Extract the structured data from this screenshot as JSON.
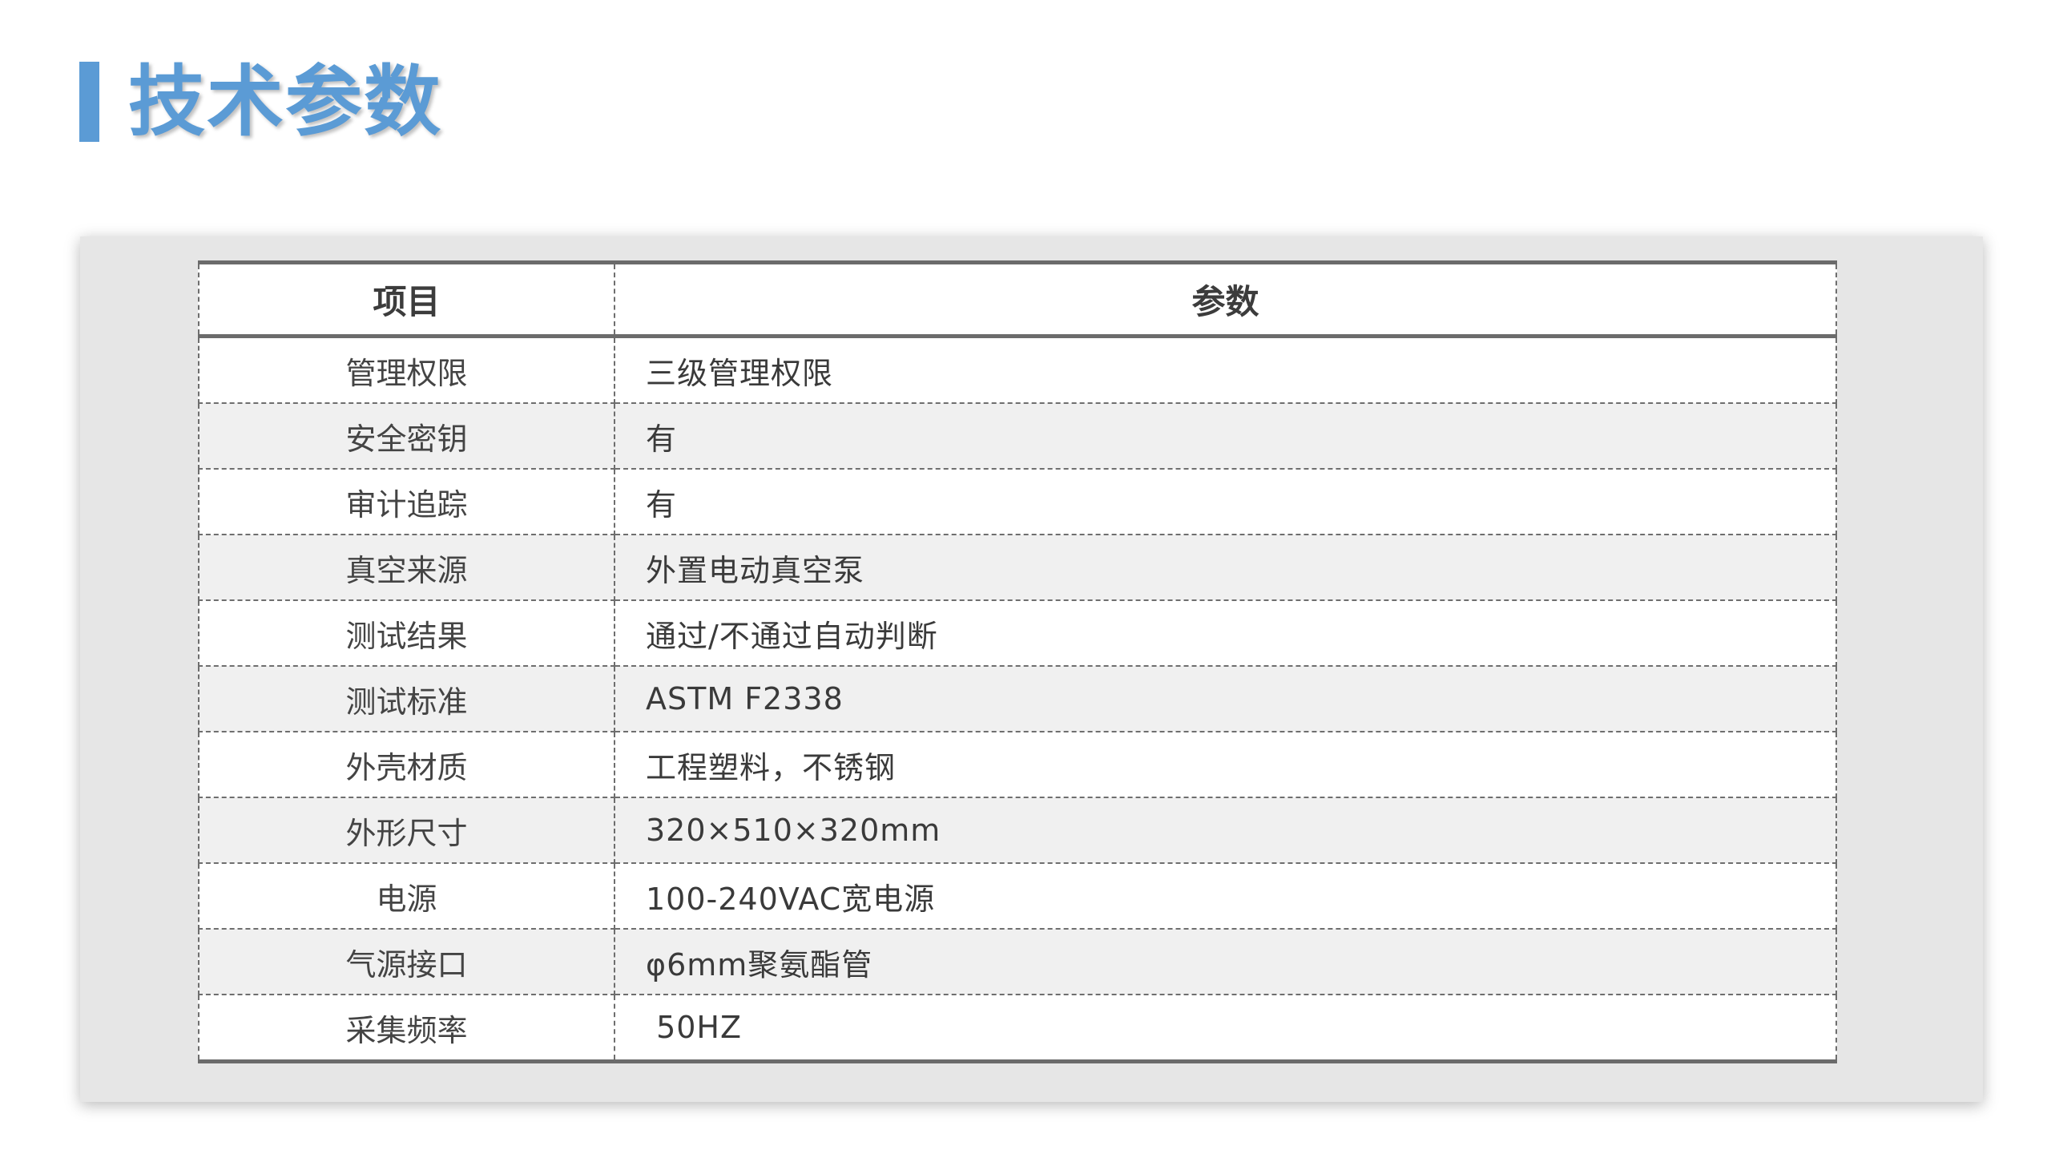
{
  "page": {
    "title": "技术参数",
    "accent_color": "#5b9bd5"
  },
  "table": {
    "headers": [
      "项目",
      "参数"
    ],
    "rows": [
      {
        "item": "管理权限",
        "value": "三级管理权限"
      },
      {
        "item": "安全密钥",
        "value": "有"
      },
      {
        "item": "审计追踪",
        "value": "有"
      },
      {
        "item": "真空来源",
        "value": "外置电动真空泵"
      },
      {
        "item": "测试结果",
        "value": "通过/不通过自动判断"
      },
      {
        "item": "测试标准",
        "value": "ASTM F2338"
      },
      {
        "item": "外壳材质",
        "value": "工程塑料，不锈钢"
      },
      {
        "item": "外形尺寸",
        "value": "320×510×320mm"
      },
      {
        "item": "电源",
        "value": "100-240VAC宽电源"
      },
      {
        "item": "气源接口",
        "value": "φ6mm聚氨酯管"
      },
      {
        "item": "采集频率",
        "value": " 50HZ"
      }
    ]
  }
}
